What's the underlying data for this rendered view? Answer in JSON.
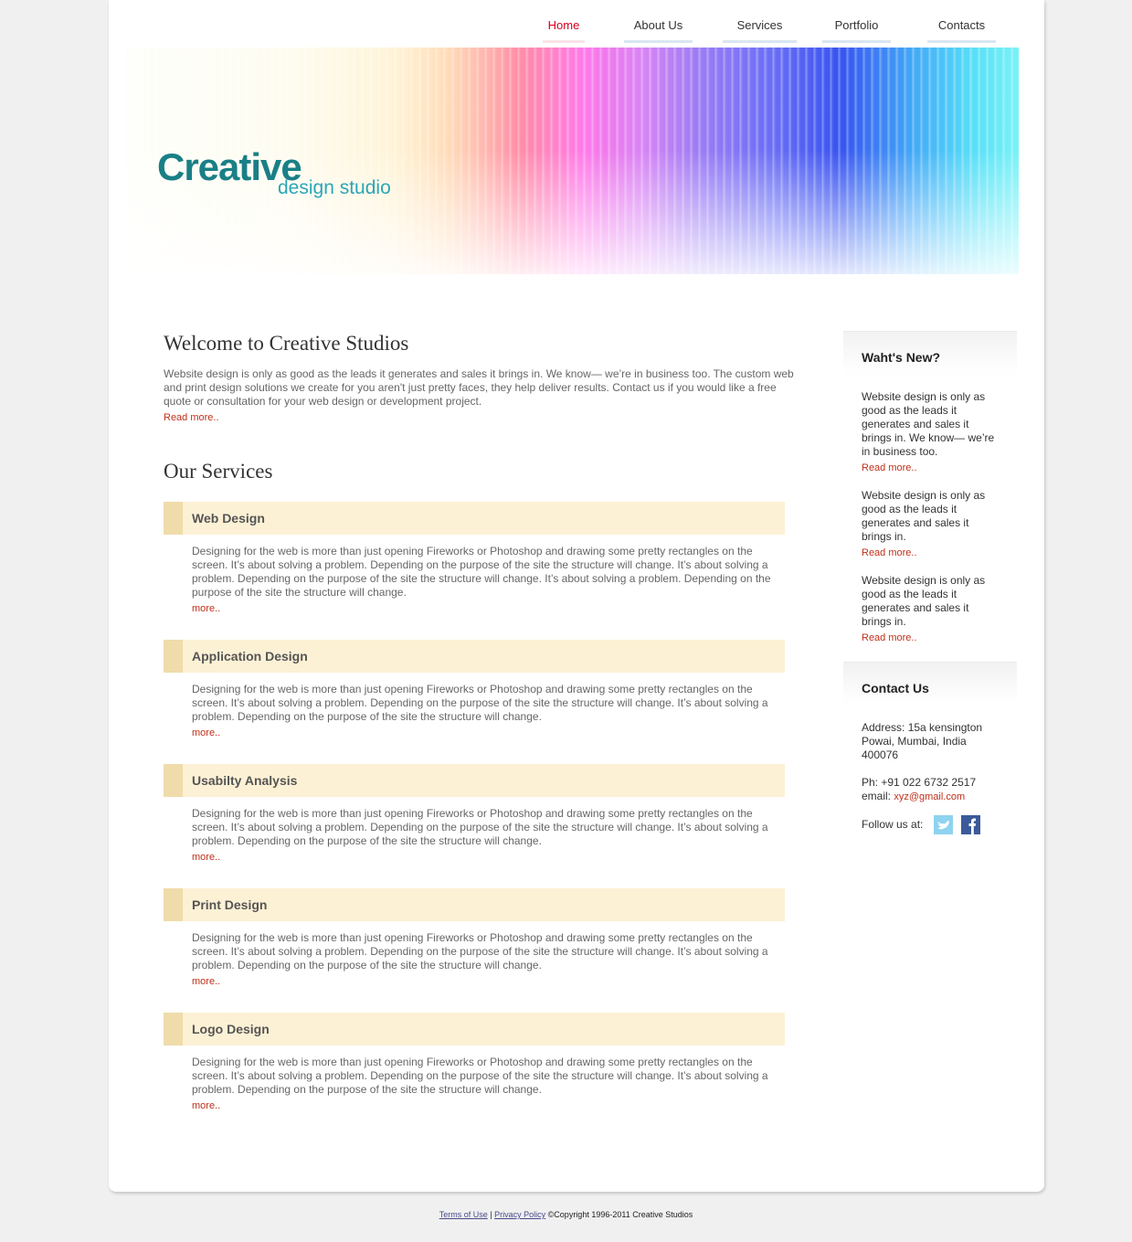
{
  "nav": {
    "items": [
      {
        "label": "Home",
        "active": true
      },
      {
        "label": "About Us"
      },
      {
        "label": "Services"
      },
      {
        "label": "Portfolio"
      },
      {
        "label": "Contacts"
      }
    ]
  },
  "banner": {
    "logo_main": "Creative",
    "logo_sub": "design studio"
  },
  "welcome": {
    "title": "Welcome to Creative Studios",
    "text": "Website design is only as good as the leads it generates and sales it brings in. We know— we’re in business too. The custom web and print design solutions we create for you aren't just pretty faces, they help deliver results. Contact us if you would like a free quote or consultation for your web design or development project.",
    "read_more": "Read more.."
  },
  "services": {
    "title": "Our Services",
    "items": [
      {
        "title": "Web Design",
        "text": "Designing for the web is more than just opening Fireworks or Photoshop and drawing some pretty rectangles on the screen. It’s about solving a problem. Depending on the purpose of the site the structure will change. It’s about solving a problem. Depending on the purpose of the site the structure will change. It’s about solving a problem. Depending on the purpose of the site the structure will change.",
        "more": "more.."
      },
      {
        "title": "Application Design",
        "text": "Designing for the web is more than just opening Fireworks or Photoshop and drawing some pretty rectangles on the screen. It’s about solving a problem. Depending on the purpose of the site the structure will change. It’s about solving a problem. Depending on the purpose of the site the structure will change.",
        "more": "more.."
      },
      {
        "title": "Usabilty Analysis",
        "text": "Designing for the web is more than just opening Fireworks or Photoshop and drawing some pretty rectangles on the screen. It’s about solving a problem. Depending on the purpose of the site the structure will change. It’s about solving a problem. Depending on the purpose of the site the structure will change.",
        "more": "more.."
      },
      {
        "title": "Print Design",
        "text": "Designing for the web is more than just opening Fireworks or Photoshop and drawing some pretty rectangles on the screen. It’s about solving a problem. Depending on the purpose of the site the structure will change. It’s about solving a problem. Depending on the purpose of the site the structure will change.",
        "more": "more.."
      },
      {
        "title": "Logo Design",
        "text": "Designing for the web is more than just opening Fireworks or Photoshop and drawing some pretty rectangles on the screen. It’s about solving a problem. Depending on the purpose of the site the structure will change. It’s about solving a problem. Depending on the purpose of the site the structure will change.",
        "more": "more.."
      }
    ]
  },
  "whats_new": {
    "title": "Waht's New?",
    "items": [
      {
        "text": "Website design is only as good as the leads it generates and sales it brings in. We know— we’re in business too.",
        "more": "Read more.."
      },
      {
        "text": "Website design is only as good as the leads it generates and sales it brings in.",
        "more": "Read more.."
      },
      {
        "text": "Website design is only as good as the leads it generates and sales it brings in.",
        "more": "Read more.."
      }
    ]
  },
  "contact": {
    "title": "Contact Us",
    "address": "Address: 15a kensington Powai, Mumbai, India 400076",
    "phone": "Ph: +91 022 6732 2517",
    "email_label": "email:",
    "email": "xyz@gmail.com",
    "follow": "Follow us at:",
    "icons": [
      "twitter-icon",
      "facebook-icon"
    ]
  },
  "footer": {
    "terms": "Terms of Use",
    "separator": "|",
    "privacy": "Privacy Policy",
    "copyright": "©Copyright 1996-2011 Creative Studios"
  },
  "colors": {
    "accent_red": "#d8001f",
    "link_red": "#c0301a",
    "logo_teal": "#1a7f86",
    "service_bar": "#fdf1d5"
  }
}
